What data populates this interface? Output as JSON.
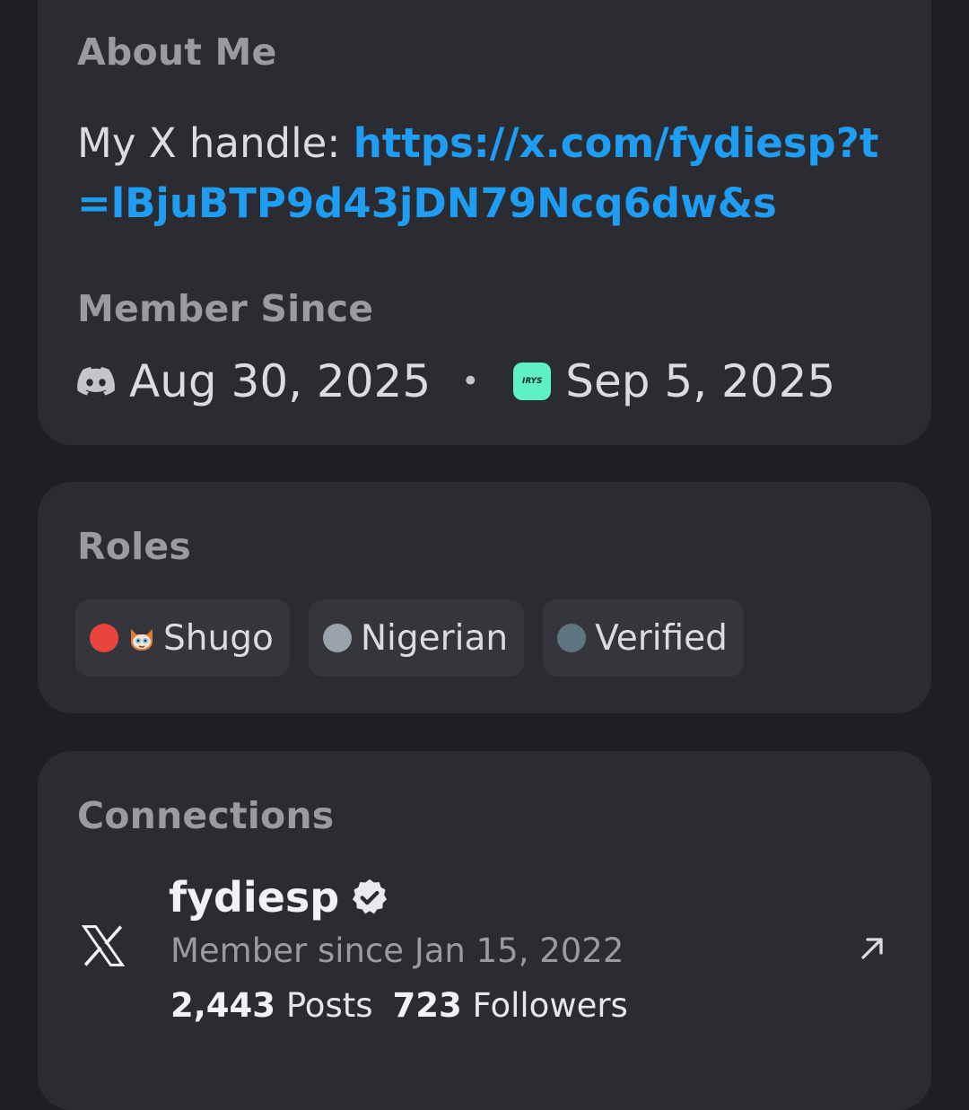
{
  "about": {
    "title": "About Me",
    "text_prefix": "My X handle: ",
    "link": "https://x.com/fydiesp?t=lBjuBTP9d43jDN79Ncq6dw&s"
  },
  "member_since": {
    "title": "Member Since",
    "discord_date": "Aug 30, 2025",
    "separator": "•",
    "server_icon_text": "IRYS",
    "server_date": "Sep 5, 2025"
  },
  "roles": {
    "title": "Roles",
    "items": [
      {
        "label": "Shugo",
        "color": "#e8463d",
        "emoji": "cat-face-icon"
      },
      {
        "label": "Nigerian",
        "color": "#9aa3ac"
      },
      {
        "label": "Verified",
        "color": "#5f7580"
      }
    ]
  },
  "connections": {
    "title": "Connections",
    "items": [
      {
        "service": "x-logo-icon",
        "name": "fydiesp",
        "verified": true,
        "member_since": "Member since Jan 15, 2022",
        "posts_count": "2,443",
        "posts_label": "Posts",
        "followers_count": "723",
        "followers_label": "Followers"
      }
    ]
  },
  "colors": {
    "background": "#1e1f23",
    "card": "#2b2c31",
    "pill": "#35363c",
    "link": "#1e9df2",
    "muted": "#9a9ba2"
  }
}
